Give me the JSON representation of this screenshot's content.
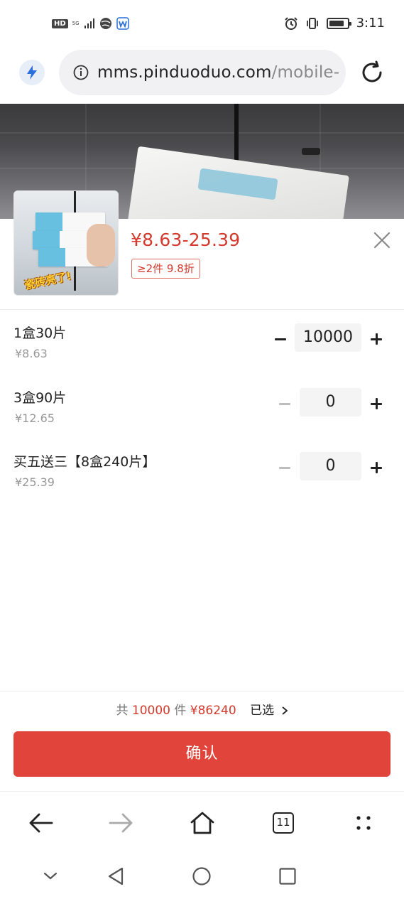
{
  "status_bar": {
    "hd": "HD",
    "network": "5G",
    "time": "3:11",
    "battery_level": 0.85
  },
  "browser": {
    "url_host": "mms.pinduoduo.com",
    "url_path": "/mobile-",
    "tab_count": "11"
  },
  "product": {
    "thumbnail_caption": "瓷砖亮了!",
    "price_range": "¥8.63-25.39",
    "discount_tag": "≥2件 9.8折",
    "accent_color": "#d3392d"
  },
  "skus": [
    {
      "name": "1盒30片",
      "price": "¥8.63",
      "quantity": "10000",
      "minus_enabled": true
    },
    {
      "name": "3盒90片",
      "price": "¥12.65",
      "quantity": "0",
      "minus_enabled": false
    },
    {
      "name": "买五送三【8盒240片】",
      "price": "¥25.39",
      "quantity": "0",
      "minus_enabled": false
    }
  ],
  "summary": {
    "prefix": "共",
    "count": "10000",
    "unit": "件",
    "total": "¥86240",
    "selected_label": "已选",
    "selected_icon": "chevron-right-icon"
  },
  "confirm": {
    "label": "确认",
    "color": "#e0443a"
  },
  "toolbar_icons": [
    "back-arrow-icon",
    "forward-arrow-icon",
    "home-icon",
    "tabs-icon",
    "more-icon"
  ],
  "nav_icons": [
    "collapse-chevron-icon",
    "back-triangle-icon",
    "home-circle-icon",
    "recents-square-icon"
  ]
}
